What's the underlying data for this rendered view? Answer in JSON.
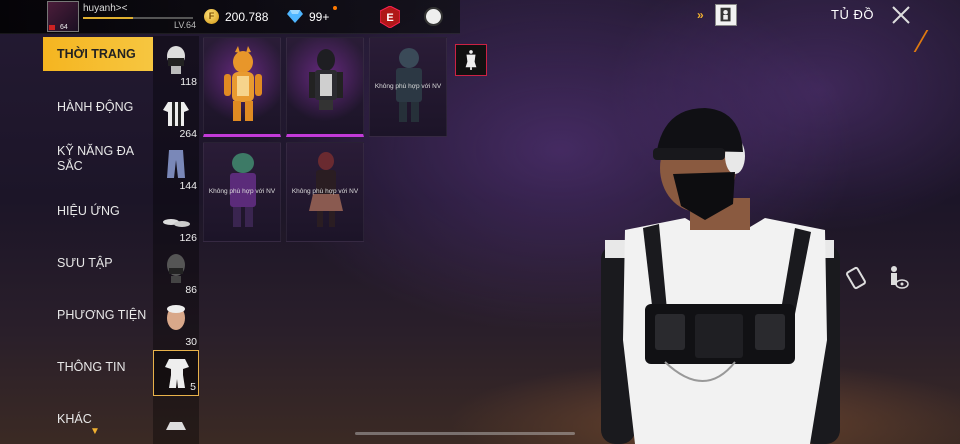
{
  "player": {
    "name": "huyanh><",
    "level": "LV.64",
    "avatar_level": "64",
    "xp_fraction": 0.45
  },
  "currency": {
    "gold": "200.788",
    "diamonds": "99+"
  },
  "topbar": {
    "title": "TỦ ĐỒ"
  },
  "categories": [
    {
      "label": "THỜI TRANG",
      "active": true
    },
    {
      "label": "HÀNH ĐỘNG",
      "active": false
    },
    {
      "label": "KỸ NĂNG ĐA SẮC",
      "active": false
    },
    {
      "label": "HIỆU ỨNG",
      "active": false
    },
    {
      "label": "SƯU TẬP",
      "active": false
    },
    {
      "label": "PHƯƠNG TIỆN",
      "active": false
    },
    {
      "label": "THÔNG TIN",
      "active": false
    },
    {
      "label": "KHÁC",
      "active": false
    }
  ],
  "subcategories": [
    {
      "icon": "mask-icon",
      "count": "118"
    },
    {
      "icon": "top-icon",
      "count": "264"
    },
    {
      "icon": "pants-icon",
      "count": "144"
    },
    {
      "icon": "shoes-icon",
      "count": "126"
    },
    {
      "icon": "head-icon",
      "count": "86"
    },
    {
      "icon": "face-icon",
      "count": "30"
    },
    {
      "icon": "outfit-set-icon",
      "count": "5",
      "active": true
    },
    {
      "icon": "extra-icon",
      "count": ""
    }
  ],
  "items": [
    {
      "name": "tiger-costume",
      "note": "",
      "owned": true
    },
    {
      "name": "hooded-vest-outfit",
      "note": "",
      "owned": true
    },
    {
      "name": "armored-outfit",
      "note": "Không phù hợp với NV",
      "owned": false
    },
    {
      "name": "green-mech-outfit",
      "note": "Không phù hợp với NV",
      "owned": false
    },
    {
      "name": "plaid-skirt-outfit",
      "note": "Không phù hợp với NV",
      "owned": false
    }
  ],
  "colors": {
    "accent": "#f5b520",
    "owned_bar": "#c23ad8",
    "danger": "#c22222"
  }
}
